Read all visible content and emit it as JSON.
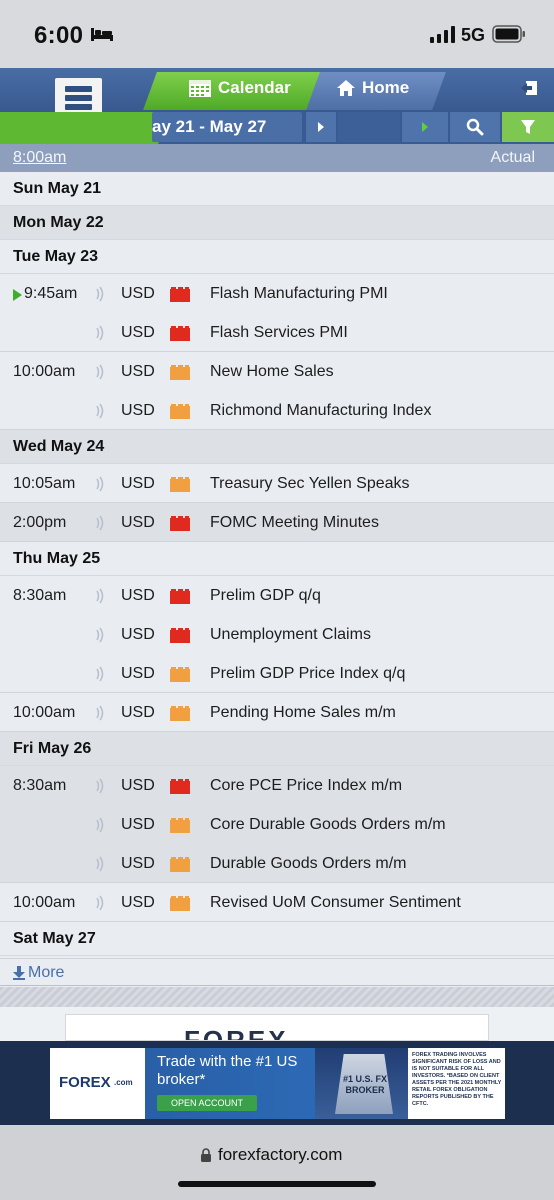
{
  "status_bar": {
    "time": "6:00",
    "network": "5G"
  },
  "header": {
    "tab_calendar": "Calendar",
    "tab_home": "Home",
    "date_range": "ay 21 - May 27"
  },
  "columns": {
    "time_link": "8:00am",
    "actual": "Actual"
  },
  "days": {
    "sun": "Sun May 21",
    "mon": "Mon May 22",
    "tue": "Tue May 23",
    "wed": "Wed May 24",
    "thu": "Thu May 25",
    "fri": "Fri May 26",
    "sat": "Sat May 27"
  },
  "events": [
    {
      "time": "9:45am",
      "currency": "USD",
      "impact": "high",
      "title": "Flash Manufacturing PMI"
    },
    {
      "time": "",
      "currency": "USD",
      "impact": "high",
      "title": "Flash Services PMI"
    },
    {
      "time": "10:00am",
      "currency": "USD",
      "impact": "medium",
      "title": "New Home Sales"
    },
    {
      "time": "",
      "currency": "USD",
      "impact": "medium",
      "title": "Richmond Manufacturing Index"
    },
    {
      "time": "10:05am",
      "currency": "USD",
      "impact": "medium",
      "title": "Treasury Sec Yellen Speaks"
    },
    {
      "time": "2:00pm",
      "currency": "USD",
      "impact": "high",
      "title": "FOMC Meeting Minutes"
    },
    {
      "time": "8:30am",
      "currency": "USD",
      "impact": "high",
      "title": "Prelim GDP q/q"
    },
    {
      "time": "",
      "currency": "USD",
      "impact": "high",
      "title": "Unemployment Claims"
    },
    {
      "time": "",
      "currency": "USD",
      "impact": "medium",
      "title": "Prelim GDP Price Index q/q"
    },
    {
      "time": "10:00am",
      "currency": "USD",
      "impact": "medium",
      "title": "Pending Home Sales m/m"
    },
    {
      "time": "8:30am",
      "currency": "USD",
      "impact": "high",
      "title": "Core PCE Price Index m/m"
    },
    {
      "time": "",
      "currency": "USD",
      "impact": "medium",
      "title": "Core Durable Goods Orders m/m"
    },
    {
      "time": "",
      "currency": "USD",
      "impact": "medium",
      "title": "Durable Goods Orders m/m"
    },
    {
      "time": "10:00am",
      "currency": "USD",
      "impact": "medium",
      "title": "Revised UoM Consumer Sentiment"
    }
  ],
  "more_label": "More",
  "ad": {
    "peek_text": "FOREX",
    "logo_text": "FOREX",
    "logo_suffix": ".com",
    "headline": "Trade with the #1 US broker*",
    "cta": "OPEN ACCOUNT",
    "badge": "#1 U.S. FX BROKER",
    "badge_footer": "FOREX.com",
    "disclaimer": "FOREX TRADING INVOLVES SIGNIFICANT RISK OF LOSS AND IS NOT SUITABLE FOR ALL INVESTORS. *BASED ON CLIENT ASSETS PER THE 2021 MONTHLY RETAIL FOREX OBLIGATION REPORTS PUBLISHED BY THE CFTC."
  },
  "url": "forexfactory.com",
  "colors": {
    "high_impact": "#e02a1f",
    "medium_impact": "#f0a040",
    "accent_green": "#5fb832",
    "header_blue": "#2f4f80"
  }
}
